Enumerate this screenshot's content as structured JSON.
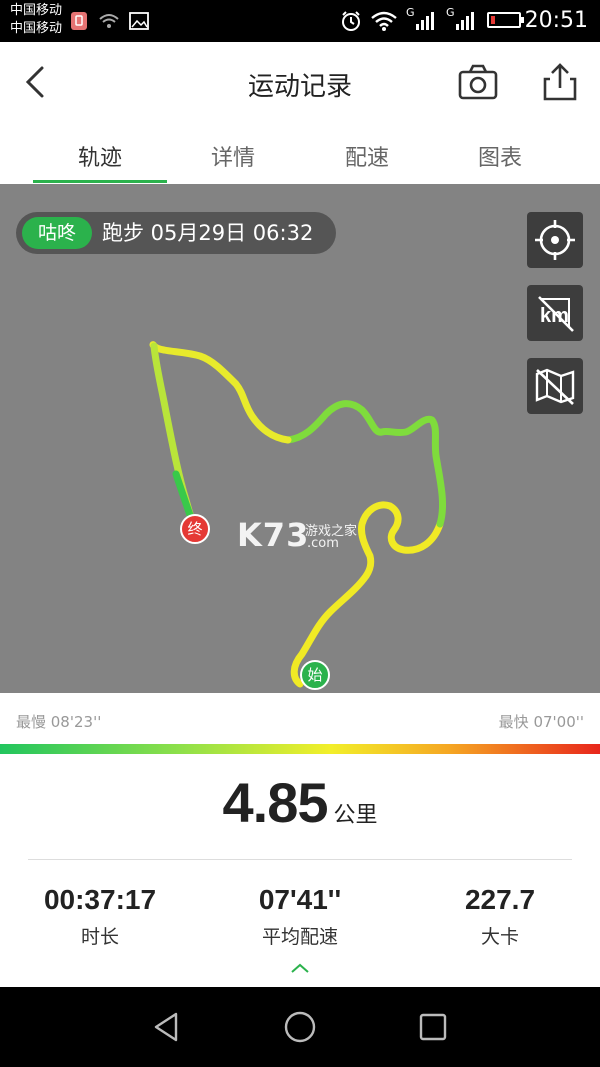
{
  "status_bar": {
    "carrier_1": "中国移动",
    "carrier_2": "中国移动",
    "time": "20:51",
    "signal_label_1": "G",
    "signal_label_2": "G"
  },
  "header": {
    "title": "运动记录"
  },
  "tabs": [
    {
      "label": "轨迹",
      "active": true
    },
    {
      "label": "详情",
      "active": false
    },
    {
      "label": "配速",
      "active": false
    },
    {
      "label": "图表",
      "active": false
    }
  ],
  "map": {
    "tag": "咕咚",
    "activity_info": "跑步  05月29日 06:32",
    "end_marker": "终",
    "start_marker": "始",
    "watermark_big": "K73",
    "watermark_small": "游戏之家",
    "watermark_com": ".com"
  },
  "pace": {
    "slowest": "最慢 08'23''",
    "fastest": "最快 07'00''"
  },
  "summary": {
    "distance_value": "4.85",
    "distance_unit": "公里",
    "stats": [
      {
        "value": "00:37:17",
        "label": "时长"
      },
      {
        "value": "07'41''",
        "label": "平均配速"
      },
      {
        "value": "227.7",
        "label": "大卡"
      }
    ]
  },
  "colors": {
    "accent": "#2bb24c",
    "map_bg": "#838383",
    "end_marker": "#e53935"
  }
}
